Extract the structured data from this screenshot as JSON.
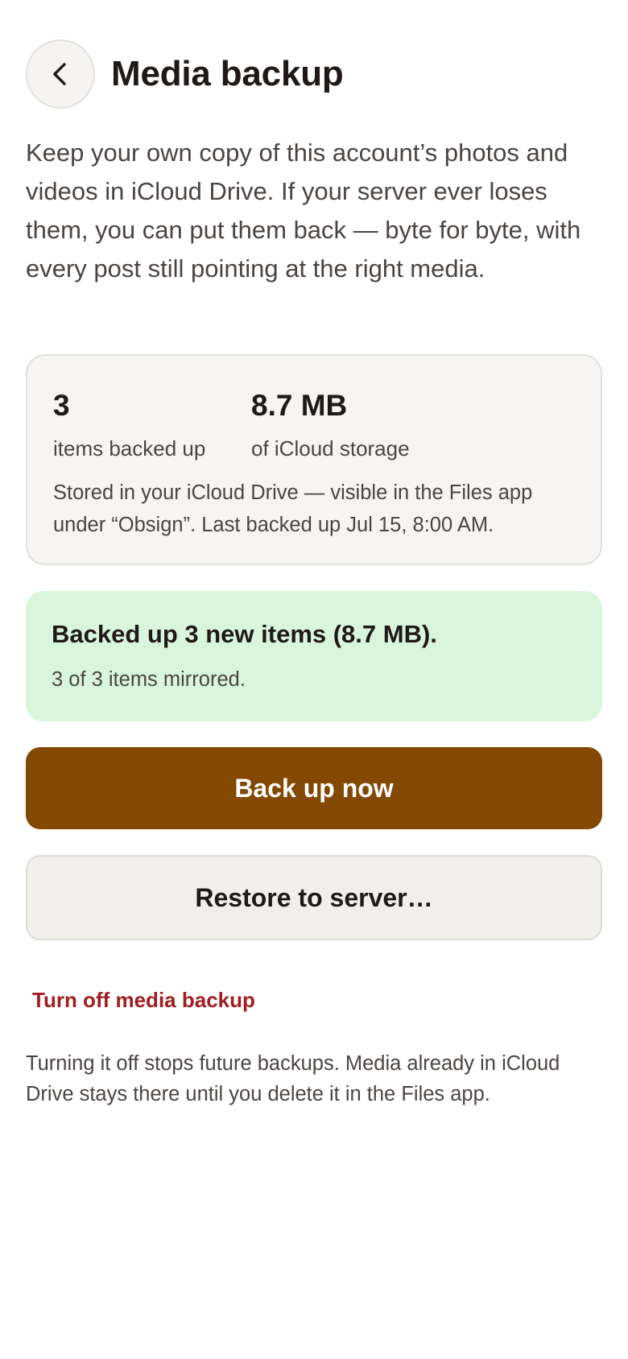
{
  "header": {
    "title": "Media backup",
    "back_icon": "chevron-left-icon"
  },
  "intro": {
    "text": "Keep your own copy of this account’s photos and videos in iCloud Drive. If your server ever loses them, you can put them back — byte for byte, with every post still pointing at the right media."
  },
  "stats": {
    "items_value": "3",
    "items_label": "items backed up",
    "storage_value": "8.7 MB",
    "storage_label": "of iCloud storage",
    "note": "Stored in your iCloud Drive — visible in the Files app under “Obsign”. Last backed up Jul 15, 8:00 AM."
  },
  "status": {
    "title": "Backed up 3 new items (8.7 MB).",
    "subtitle": "3 of 3 items mirrored."
  },
  "actions": {
    "backup_label": "Back up now",
    "restore_label": "Restore to server…",
    "turn_off_label": "Turn off media backup"
  },
  "footnote": {
    "text": "Turning it off stops future backups. Media already in iCloud Drive stays there until you delete it in the Files app."
  },
  "colors": {
    "primary": "#834902",
    "success_bg": "#d9f6dd",
    "danger": "#a01e22",
    "text": "#1f1a17",
    "muted_text": "#4a4542"
  }
}
